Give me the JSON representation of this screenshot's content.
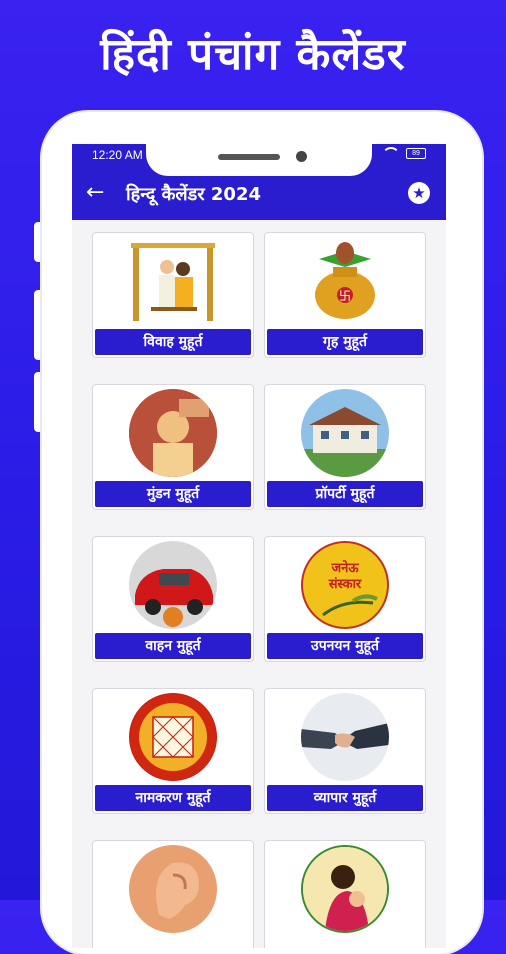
{
  "promo": {
    "title": "हिंदी पंचांग कैलेंडर"
  },
  "status": {
    "time": "12:20 AM",
    "battery": "89"
  },
  "appbar": {
    "back_icon": "arrow-left-icon",
    "title": "हिन्दू कैलेंडर 2024",
    "fav_icon": "star-icon"
  },
  "cards": [
    {
      "label": "विवाह मुहूर्त",
      "icon": "wedding-swing-icon"
    },
    {
      "label": "गृह मुहूर्त",
      "icon": "kalash-icon"
    },
    {
      "label": "मुंडन मुहूर्त",
      "icon": "child-haircut-icon"
    },
    {
      "label": "प्रॉपर्टी मुहूर्त",
      "icon": "house-icon"
    },
    {
      "label": "वाहन मुहूर्त",
      "icon": "car-icon"
    },
    {
      "label": "उपनयन मुहूर्त",
      "icon": "janeu-sanskar-icon",
      "image_text": "जनेऊ संस्कार"
    },
    {
      "label": "नामकरण मुहूर्त",
      "icon": "zodiac-chart-icon"
    },
    {
      "label": "व्यापार मुहूर्त",
      "icon": "handshake-icon"
    },
    {
      "label": "",
      "icon": "ear-icon"
    },
    {
      "label": "",
      "icon": "mother-child-icon"
    }
  ],
  "colors": {
    "primary": "#2a1ccf",
    "background": "#3a22f0"
  }
}
